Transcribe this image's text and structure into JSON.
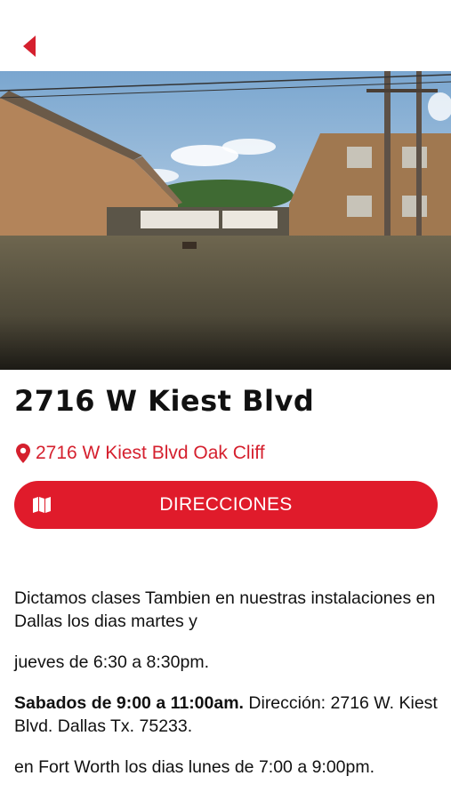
{
  "header": {
    "back_icon": "back-arrow-icon"
  },
  "photo": {
    "alt": ""
  },
  "location": {
    "title": "2716 W Kiest Blvd",
    "address": "2716 W Kiest Blvd Oak Cliff",
    "address_icon": "map-pin-icon"
  },
  "directions_button": {
    "label": "DIRECCIONES",
    "icon": "map-icon"
  },
  "description": {
    "p1": "Dictamos clases Tambien en nuestras instalaciones en Dallas los dias martes y",
    "p2": "jueves de 6:30 a 8:30pm.",
    "p3_bold": "Sabados de 9:00 a 11:00am.",
    "p3_rest": " Dirección: 2716 W. Kiest Blvd. Dallas Tx. 75233.",
    "p4": "en Fort Worth los dias lunes de 7:00 a 9:00pm."
  },
  "colors": {
    "accent": "#e01b2b",
    "text": "#111111"
  }
}
